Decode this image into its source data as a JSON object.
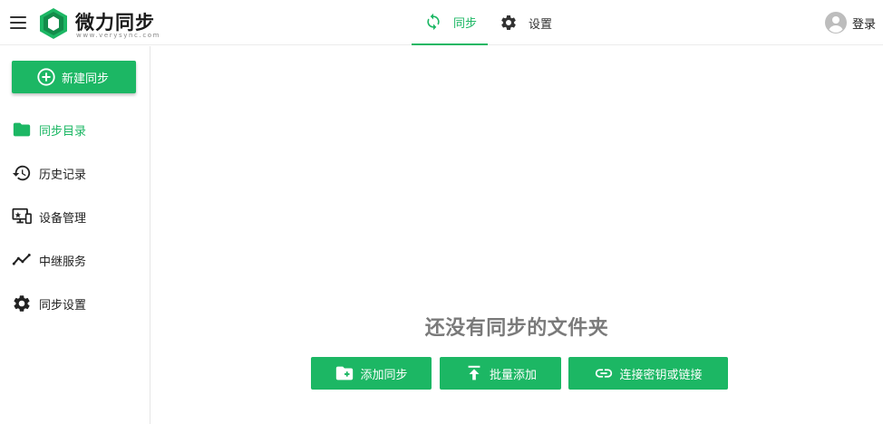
{
  "app": {
    "name": "微力同步",
    "subtitle": "www.verysync.com"
  },
  "header": {
    "tabs": [
      {
        "label": "同步",
        "icon": "sync-icon",
        "active": true
      },
      {
        "label": "设置",
        "icon": "gear-icon",
        "active": false
      }
    ],
    "login_label": "登录"
  },
  "sidebar": {
    "new_sync_label": "新建同步",
    "items": [
      {
        "label": "同步目录",
        "icon": "folder-icon",
        "active": true
      },
      {
        "label": "历史记录",
        "icon": "history-icon",
        "active": false
      },
      {
        "label": "设备管理",
        "icon": "devices-icon",
        "active": false
      },
      {
        "label": "中继服务",
        "icon": "relay-icon",
        "active": false
      },
      {
        "label": "同步设置",
        "icon": "gear-icon",
        "active": false
      }
    ]
  },
  "main": {
    "empty_title": "还没有同步的文件夹",
    "actions": [
      {
        "label": "添加同步",
        "icon": "add-folder-icon"
      },
      {
        "label": "批量添加",
        "icon": "upload-icon"
      },
      {
        "label": "连接密钥或链接",
        "icon": "link-icon"
      }
    ]
  },
  "colors": {
    "accent": "#1cb764",
    "text": "#222222",
    "muted": "#7a7a7a"
  }
}
